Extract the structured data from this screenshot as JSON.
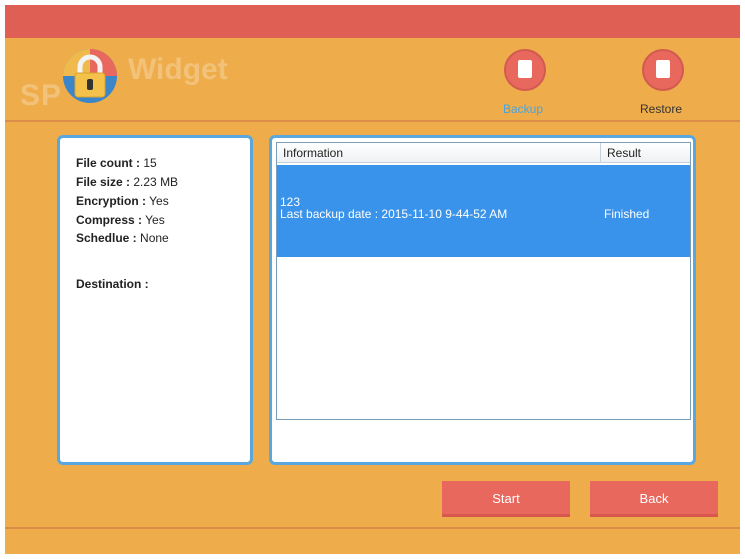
{
  "app": {
    "logo_prefix": "SP",
    "logo_name": "Widget"
  },
  "toolbar": {
    "backup_label": "Backup",
    "restore_label": "Restore"
  },
  "summary": {
    "file_count_label": "File count :",
    "file_count_value": "15",
    "file_size_label": "File size :",
    "file_size_value": "2.23 MB",
    "encryption_label": "Encryption :",
    "encryption_value": "Yes",
    "compress_label": "Compress :",
    "compress_value": "Yes",
    "schedule_label": "Schedlue :",
    "schedule_value": "None",
    "destination_label": "Destination :"
  },
  "table": {
    "columns": [
      "Information",
      "Result"
    ],
    "rows": [
      {
        "name": "123",
        "detail": "Last backup date : 2015-11-10 9-44-52 AM",
        "result": "Finished"
      }
    ]
  },
  "buttons": {
    "start": "Start",
    "back": "Back"
  },
  "colors": {
    "title_bar": "#e05f54",
    "background": "#eead4a",
    "panel_border": "#5aa7df",
    "selection": "#3a93ea",
    "button": "#e8685e"
  }
}
